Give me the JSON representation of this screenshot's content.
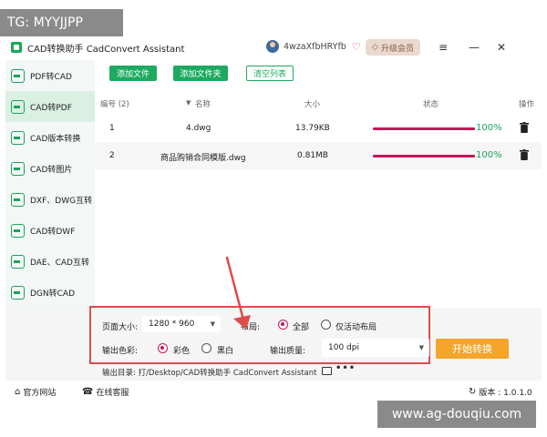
{
  "watermarks": {
    "top_left": "TG: MYYJJPP",
    "bottom_right": "www.ag-douqiu.com"
  },
  "titlebar": {
    "app_title": "CAD转换助手 CadConvert Assistant",
    "username": "4wzaXfbHRYfb",
    "upgrade_label": "升级会员",
    "icons": [
      "vip-heart-icon",
      "menu-icon",
      "minimize-icon",
      "close-icon"
    ]
  },
  "sidebar": {
    "items": [
      {
        "label": "PDF转CAD",
        "active": false
      },
      {
        "label": "CAD转PDF",
        "active": true
      },
      {
        "label": "CAD版本转换",
        "active": false
      },
      {
        "label": "CAD转图片",
        "active": false
      },
      {
        "label": "DXF、DWG互转",
        "active": false
      },
      {
        "label": "CAD转DWF",
        "active": false
      },
      {
        "label": "DAE、CAD互转",
        "active": false
      },
      {
        "label": "DGN转CAD",
        "active": false
      }
    ]
  },
  "toolbar": {
    "add_file": "添加文件",
    "add_folder": "添加文件夹",
    "clear_list": "清空列表"
  },
  "table": {
    "headers": {
      "index": "编号 (2)",
      "name": "名称",
      "size": "大小",
      "status": "状态",
      "action": "操作"
    },
    "rows": [
      {
        "index": "1",
        "name": "4.dwg",
        "size": "13.79KB",
        "percent": "100%",
        "progress": 1.0
      },
      {
        "index": "2",
        "name": "商品购销合同模版.dwg",
        "size": "0.81MB",
        "percent": "100%",
        "progress": 1.0
      }
    ]
  },
  "settings": {
    "page_size_label": "页面大小:",
    "page_size_value": "1280 * 960",
    "layout_label": "布局:",
    "layout_options": [
      "全部",
      "仅活动布局"
    ],
    "layout_selected": "全部",
    "color_label": "输出色彩:",
    "color_options": [
      "彩色",
      "黑白"
    ],
    "color_selected": "彩色",
    "quality_label": "输出质量:",
    "quality_value": "100 dpi",
    "start_button": "开始转换",
    "output_dir": "输出目录: 打/Desktop/CAD转换助手 CadConvert Assistant"
  },
  "footer": {
    "website": "官方网站",
    "support": "在线客服",
    "version": "版本 : 1.0.1.0"
  },
  "colors": {
    "brand_green": "#1daa5f",
    "progress": "#c2185b",
    "start": "#f4a52a",
    "highlight_box": "#e04b4b"
  }
}
